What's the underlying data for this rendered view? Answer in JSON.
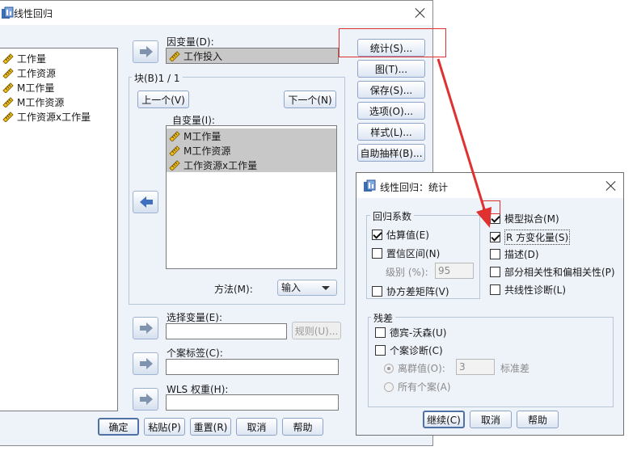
{
  "main_dialog": {
    "title": "线性回归",
    "source_vars": [
      "工作量",
      "工作资源",
      "M工作量",
      "M工作资源",
      "工作资源x工作量"
    ],
    "dependent_label": "因变量(D):",
    "dependent_value": "工作投入",
    "block_label": "块(B)1 / 1",
    "prev_button": "上一个(V)",
    "next_button": "下一个(N)",
    "independent_label": "自变量(I):",
    "independent_vars": [
      "M工作量",
      "M工作资源",
      "工作资源x工作量"
    ],
    "method_label": "方法(M):",
    "method_value": "输入",
    "selection_label": "选择变量(E):",
    "rule_button": "规则(U)...",
    "case_label_label": "个案标签(C):",
    "wls_label": "WLS 权重(H):",
    "side_buttons": [
      "统计(S)...",
      "图(T)...",
      "保存(S)...",
      "选项(O)...",
      "样式(L)...",
      "自助抽样(B)..."
    ],
    "bottom_buttons": [
      "确定",
      "粘贴(P)",
      "重置(R)",
      "取消",
      "帮助"
    ]
  },
  "stats_dialog": {
    "title": "线性回归：统计",
    "coef_group": "回归系数",
    "estimates": "估算值(E)",
    "ci": "置信区间(N)",
    "level_label": "级别 (%):",
    "level_value": "95",
    "covariance": "协方差矩阵(V)",
    "model_fit": "模型拟合(M)",
    "r_change": "R 方变化量(S)",
    "descriptives": "描述(D)",
    "part_partial": "部分相关性和偏相关性(P)",
    "collinearity": "共线性诊断(L)",
    "residuals_group": "残差",
    "durbin": "德宾-沃森(U)",
    "casewise": "个案诊断(C)",
    "outliers": "离群值(O):",
    "outliers_value": "3",
    "std_unit": "标准差",
    "all_cases": "所有个案(A)",
    "continue_button": "继续(C)",
    "cancel_button": "取消",
    "help_button": "帮助"
  },
  "colors": {
    "highlight_red": "#e03030",
    "client_bg": "#eef2f9",
    "selection_grey": "#c8c8c8"
  }
}
